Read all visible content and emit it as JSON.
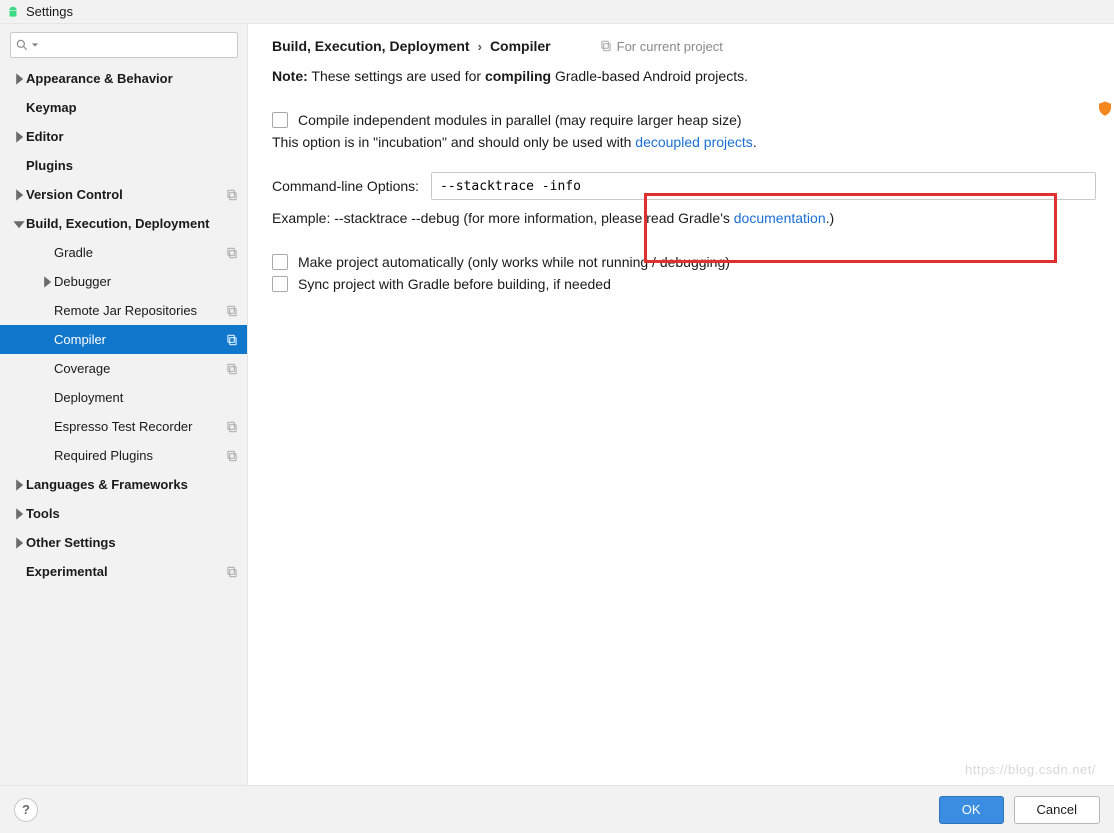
{
  "window": {
    "title": "Settings"
  },
  "search": {
    "placeholder": ""
  },
  "sidebar": {
    "items": [
      {
        "label": "Appearance & Behavior",
        "bold": true,
        "expandable": true,
        "expanded": false,
        "depth": 0
      },
      {
        "label": "Keymap",
        "bold": true,
        "expandable": false,
        "depth": 0
      },
      {
        "label": "Editor",
        "bold": true,
        "expandable": true,
        "expanded": false,
        "depth": 0
      },
      {
        "label": "Plugins",
        "bold": true,
        "expandable": false,
        "depth": 0
      },
      {
        "label": "Version Control",
        "bold": true,
        "expandable": true,
        "expanded": false,
        "depth": 0,
        "copy": true
      },
      {
        "label": "Build, Execution, Deployment",
        "bold": true,
        "expandable": true,
        "expanded": true,
        "depth": 0
      },
      {
        "label": "Gradle",
        "depth": 1,
        "copy": true
      },
      {
        "label": "Debugger",
        "depth": 1,
        "expandable": true,
        "expanded": false
      },
      {
        "label": "Remote Jar Repositories",
        "depth": 1,
        "copy": true
      },
      {
        "label": "Compiler",
        "depth": 1,
        "copy": true,
        "selected": true
      },
      {
        "label": "Coverage",
        "depth": 1,
        "copy": true
      },
      {
        "label": "Deployment",
        "depth": 1
      },
      {
        "label": "Espresso Test Recorder",
        "depth": 1,
        "copy": true
      },
      {
        "label": "Required Plugins",
        "depth": 1,
        "copy": true
      },
      {
        "label": "Languages & Frameworks",
        "bold": true,
        "expandable": true,
        "expanded": false,
        "depth": 0
      },
      {
        "label": "Tools",
        "bold": true,
        "expandable": true,
        "expanded": false,
        "depth": 0
      },
      {
        "label": "Other Settings",
        "bold": true,
        "expandable": true,
        "expanded": false,
        "depth": 0
      },
      {
        "label": "Experimental",
        "bold": true,
        "expandable": false,
        "depth": 0,
        "copy": true
      }
    ]
  },
  "breadcrumb": {
    "segment1": "Build, Execution, Deployment",
    "segment2": "Compiler",
    "scope": "For current project"
  },
  "note": {
    "prefix": "Note:",
    "text1": " These settings are used for ",
    "bold": "compiling",
    "text2": " Gradle-based Android projects."
  },
  "checks": {
    "parallel": "Compile independent modules in parallel (may require larger heap size)",
    "incubation_pre": "This option is in \"incubation\" and should only be used with ",
    "incubation_link": "decoupled projects",
    "incubation_post": ".",
    "auto": "Make project automatically (only works while not running / debugging)",
    "sync": "Sync project with Gradle before building, if needed"
  },
  "cmd": {
    "label": "Command-line Options:",
    "value": "--stacktrace -info",
    "example_pre": "Example: --stacktrace --debug (for more information, please read Gradle's ",
    "example_link": "documentation",
    "example_post": ".)"
  },
  "footer": {
    "ok": "OK",
    "cancel": "Cancel"
  },
  "watermark": "https://blog.csdn.net/"
}
